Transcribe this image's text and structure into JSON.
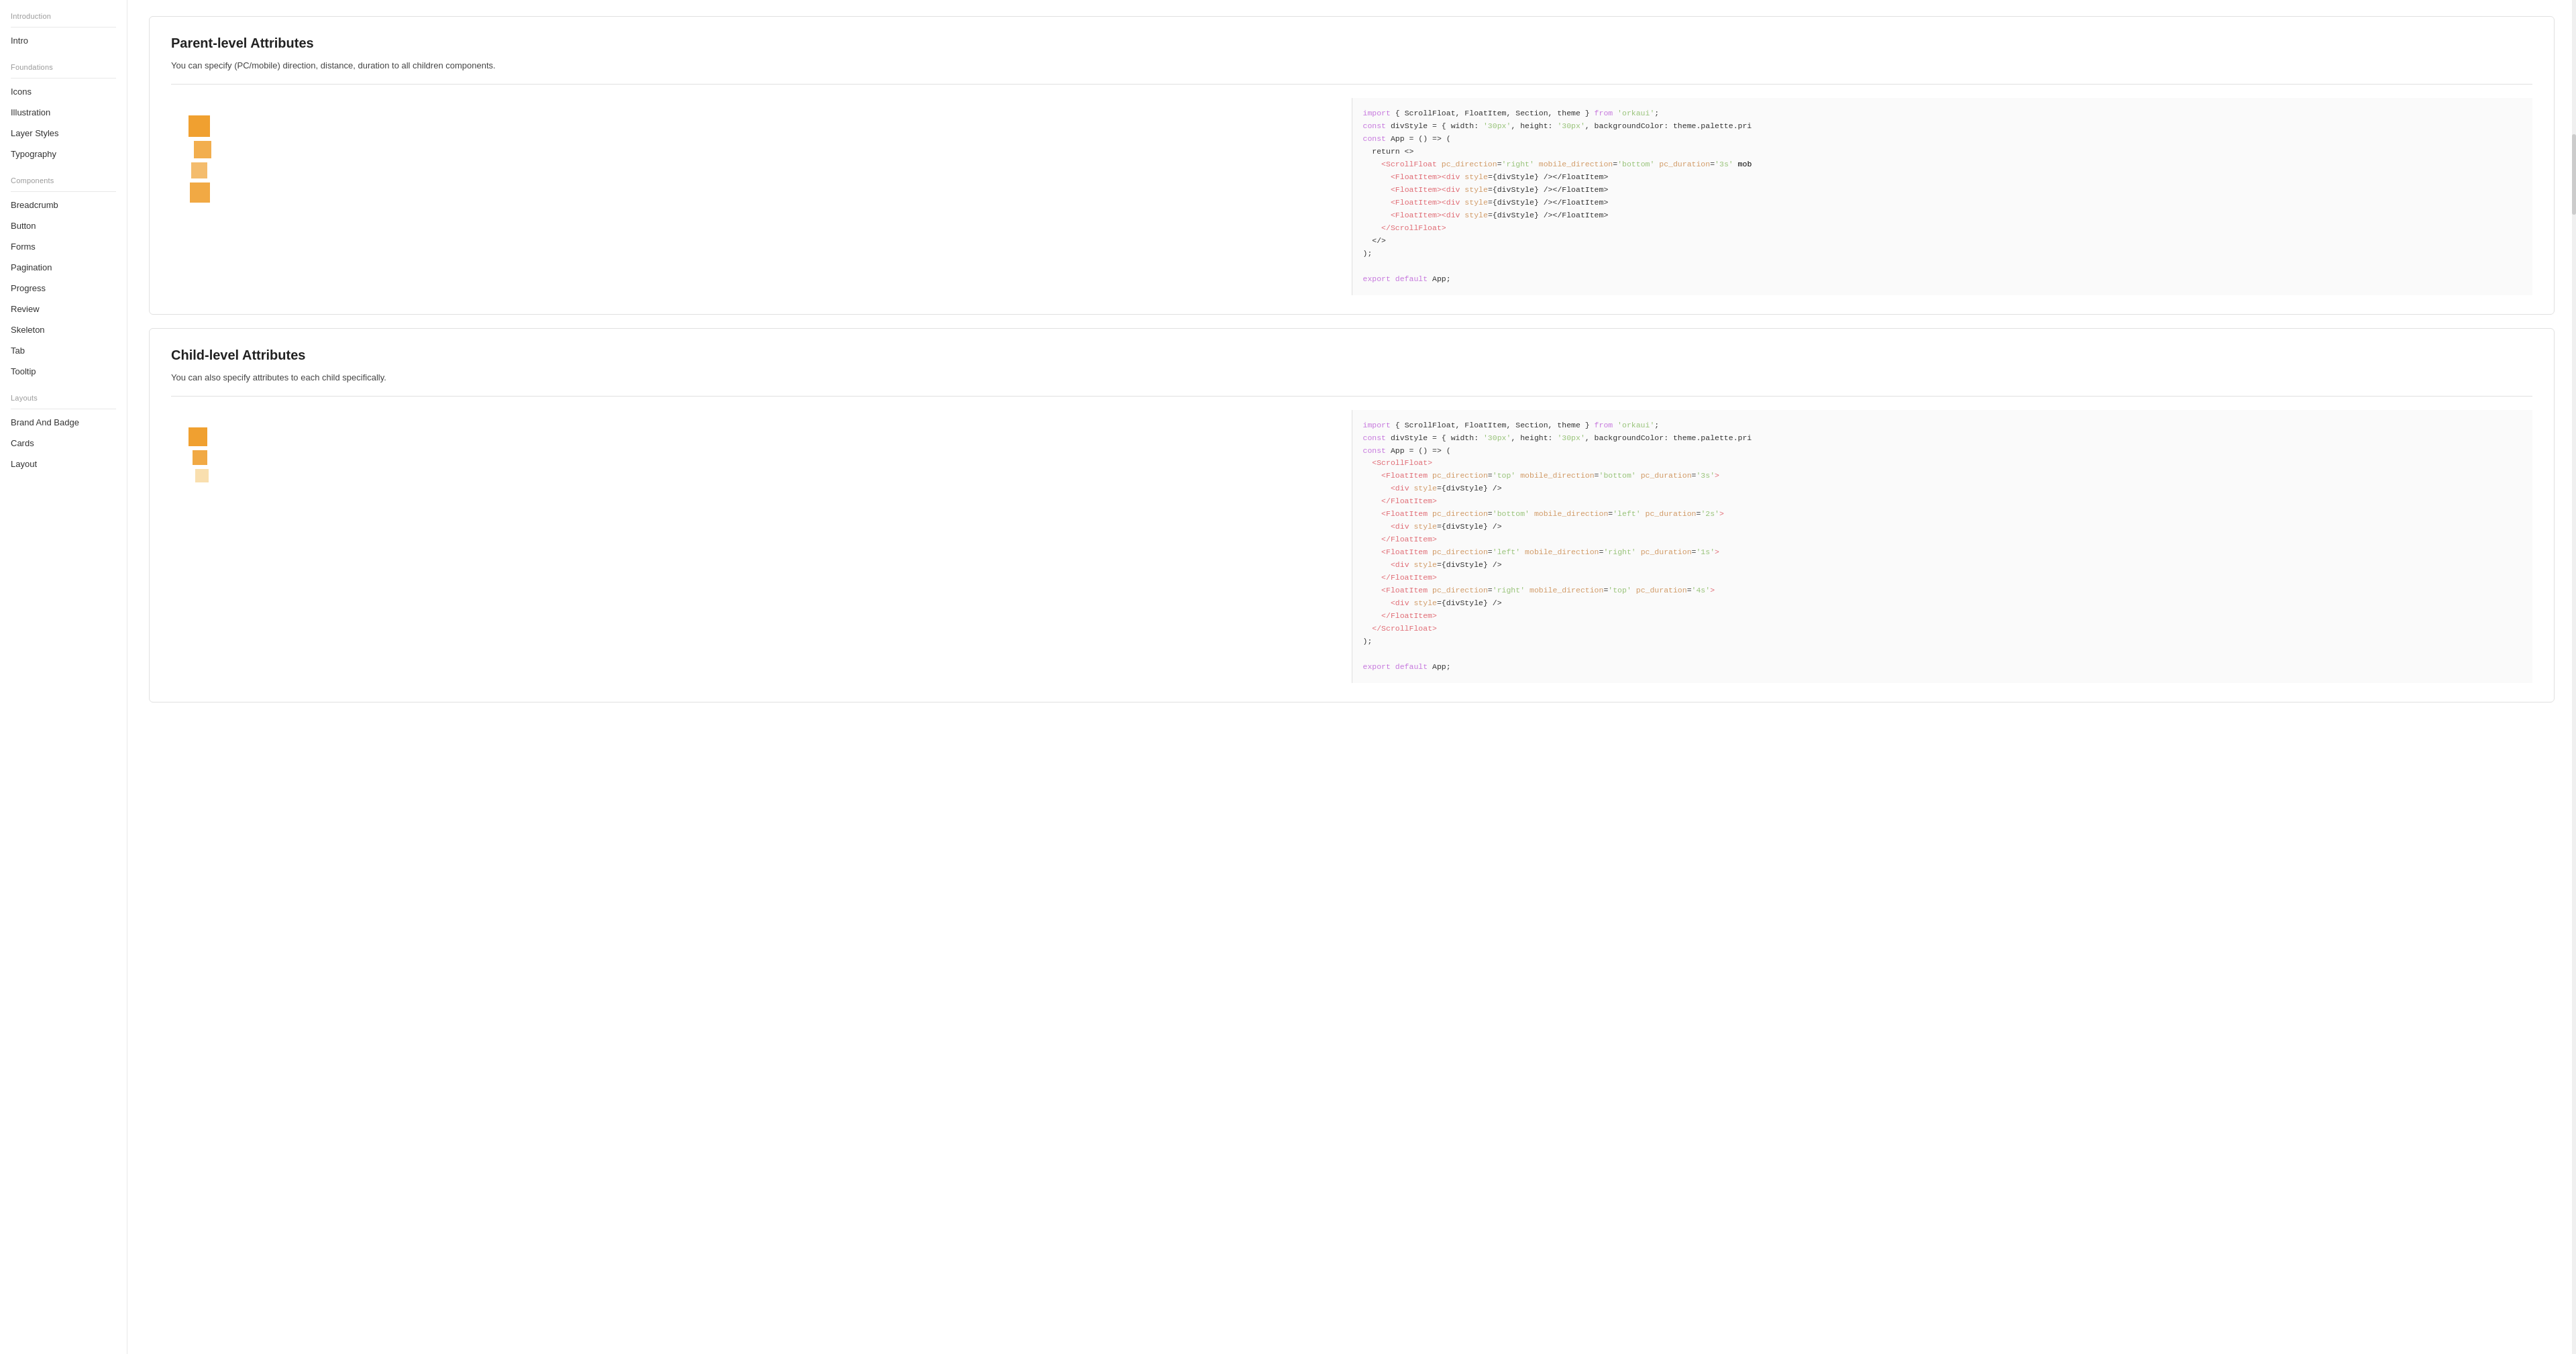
{
  "sidebar": {
    "sections": [
      {
        "label": "Introduction",
        "items": [
          {
            "id": "intro",
            "label": "Intro"
          }
        ]
      },
      {
        "label": "Foundations",
        "items": [
          {
            "id": "icons",
            "label": "Icons"
          },
          {
            "id": "illustration",
            "label": "Illustration"
          },
          {
            "id": "layer-styles",
            "label": "Layer Styles"
          },
          {
            "id": "typography",
            "label": "Typography"
          }
        ]
      },
      {
        "label": "Components",
        "items": [
          {
            "id": "breadcrumb",
            "label": "Breadcrumb"
          },
          {
            "id": "button",
            "label": "Button"
          },
          {
            "id": "forms",
            "label": "Forms"
          },
          {
            "id": "pagination",
            "label": "Pagination"
          },
          {
            "id": "progress",
            "label": "Progress"
          },
          {
            "id": "review",
            "label": "Review"
          },
          {
            "id": "skeleton",
            "label": "Skeleton"
          },
          {
            "id": "tab",
            "label": "Tab"
          },
          {
            "id": "tooltip",
            "label": "Tooltip"
          }
        ]
      },
      {
        "label": "Layouts",
        "items": [
          {
            "id": "brand-and-badge",
            "label": "Brand And Badge"
          },
          {
            "id": "cards",
            "label": "Cards"
          },
          {
            "id": "layout",
            "label": "Layout"
          }
        ]
      }
    ]
  },
  "main": {
    "sections": [
      {
        "id": "parent-level",
        "title": "Parent-level Attributes",
        "description": "You can specify (PC/mobile) direction, distance, duration to all children components.",
        "code": "import { ScrollFloat, FloatItem, Section, theme } from 'orkaui';\nconst divStyle = { width: '30px', height: '30px', backgroundColor: theme.palette.pri\nconst App = () => (\n  return <>\n    <ScrollFloat pc_direction='right' mobile_direction='bottom' pc_duration='3s' mob\n      <FloatItem><div style={divStyle} /></FloatItem>\n      <FloatItem><div style={divStyle} /></FloatItem>\n      <FloatItem><div style={divStyle} /></FloatItem>\n      <FloatItem><div style={divStyle} /></FloatItem>\n    </ScrollFloat>\n  </>\n);\n\nexport default App;",
        "squares": [
          {
            "size": 32,
            "top": 0,
            "left": 0,
            "color": "#f0a030",
            "opacity": 1
          },
          {
            "size": 26,
            "color": "#f0a030",
            "opacity": 0.85
          },
          {
            "size": 24,
            "color": "#f0a030",
            "opacity": 0.7
          },
          {
            "size": 30,
            "color": "#f0a030",
            "opacity": 0.9
          }
        ]
      },
      {
        "id": "child-level",
        "title": "Child-level Attributes",
        "description": "You can also specify attributes to each child specifically.",
        "code": "import { ScrollFloat, FloatItem, Section, theme } from 'orkaui';\nconst divStyle = { width: '30px', height: '30px', backgroundColor: theme.palette.pri\nconst App = () => (\n  <ScrollFloat>\n    <FloatItem pc_direction='top' mobile_direction='bottom' pc_duration='3s'>\n      <div style={divStyle} />\n    </FloatItem>\n    <FloatItem pc_direction='bottom' mobile_direction='left' pc_duration='2s'>\n      <div style={divStyle} />\n    </FloatItem>\n    <FloatItem pc_direction='left' mobile_direction='right' pc_duration='1s'>\n      <div style={divStyle} />\n    </FloatItem>\n    <FloatItem pc_direction='right' mobile_direction='top' pc_duration='4s'>\n      <div style={divStyle} />\n    </FloatItem>\n  </ScrollFloat>\n);\n\nexport default App;",
        "squares": [
          {
            "size": 28,
            "color": "#f0a030",
            "opacity": 1
          },
          {
            "size": 22,
            "color": "#f0a030",
            "opacity": 0.9
          },
          {
            "size": 20,
            "color": "#f4c060",
            "opacity": 0.5
          }
        ]
      }
    ]
  },
  "colors": {
    "code_import_keyword": "#c678dd",
    "code_component": "#61afef",
    "code_string": "#98c379",
    "code_attr": "#d19a66",
    "code_text": "#333333",
    "code_tag": "#e06c75",
    "sidebar_divider": "#e8e8e8",
    "card_border": "#e0e0e0"
  }
}
